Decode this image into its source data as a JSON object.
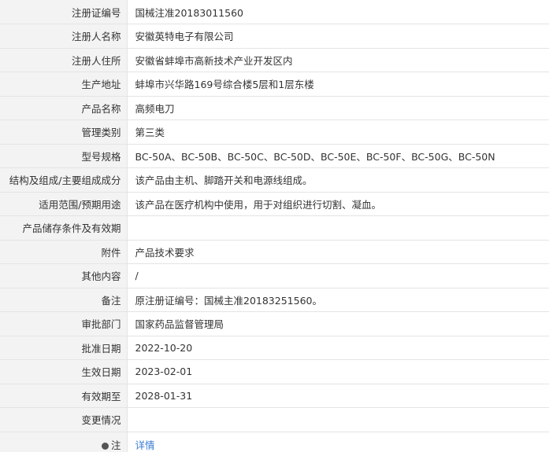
{
  "rows": [
    {
      "label": "注册证编号",
      "value": "国械注准20183011560"
    },
    {
      "label": "注册人名称",
      "value": "安徽英特电子有限公司"
    },
    {
      "label": "注册人住所",
      "value": "安徽省蚌埠市高新技术产业开发区内"
    },
    {
      "label": "生产地址",
      "value": "蚌埠市兴华路169号综合楼5层和1层东楼"
    },
    {
      "label": "产品名称",
      "value": "高频电刀"
    },
    {
      "label": "管理类别",
      "value": "第三类"
    },
    {
      "label": "型号规格",
      "value": "BC-50A、BC-50B、BC-50C、BC-50D、BC-50E、BC-50F、BC-50G、BC-50N"
    },
    {
      "label": "结构及组成/主要组成成分",
      "value": "该产品由主机、脚踏开关和电源线组成。"
    },
    {
      "label": "适用范围/预期用途",
      "value": "该产品在医疗机构中使用，用于对组织进行切割、凝血。"
    },
    {
      "label": "产品储存条件及有效期",
      "value": ""
    },
    {
      "label": "附件",
      "value": "产品技术要求"
    },
    {
      "label": "其他内容",
      "value": "/"
    },
    {
      "label": "备注",
      "value": "原注册证编号：国械主准20183251560。"
    },
    {
      "label": "审批部门",
      "value": "国家药品监督管理局"
    },
    {
      "label": "批准日期",
      "value": "2022-10-20"
    },
    {
      "label": "生效日期",
      "value": "2023-02-01"
    },
    {
      "label": "有效期至",
      "value": "2028-01-31"
    },
    {
      "label": "变更情况",
      "value": ""
    }
  ],
  "note": {
    "label": "注",
    "icon": "dot-icon",
    "link_text": "详情"
  }
}
